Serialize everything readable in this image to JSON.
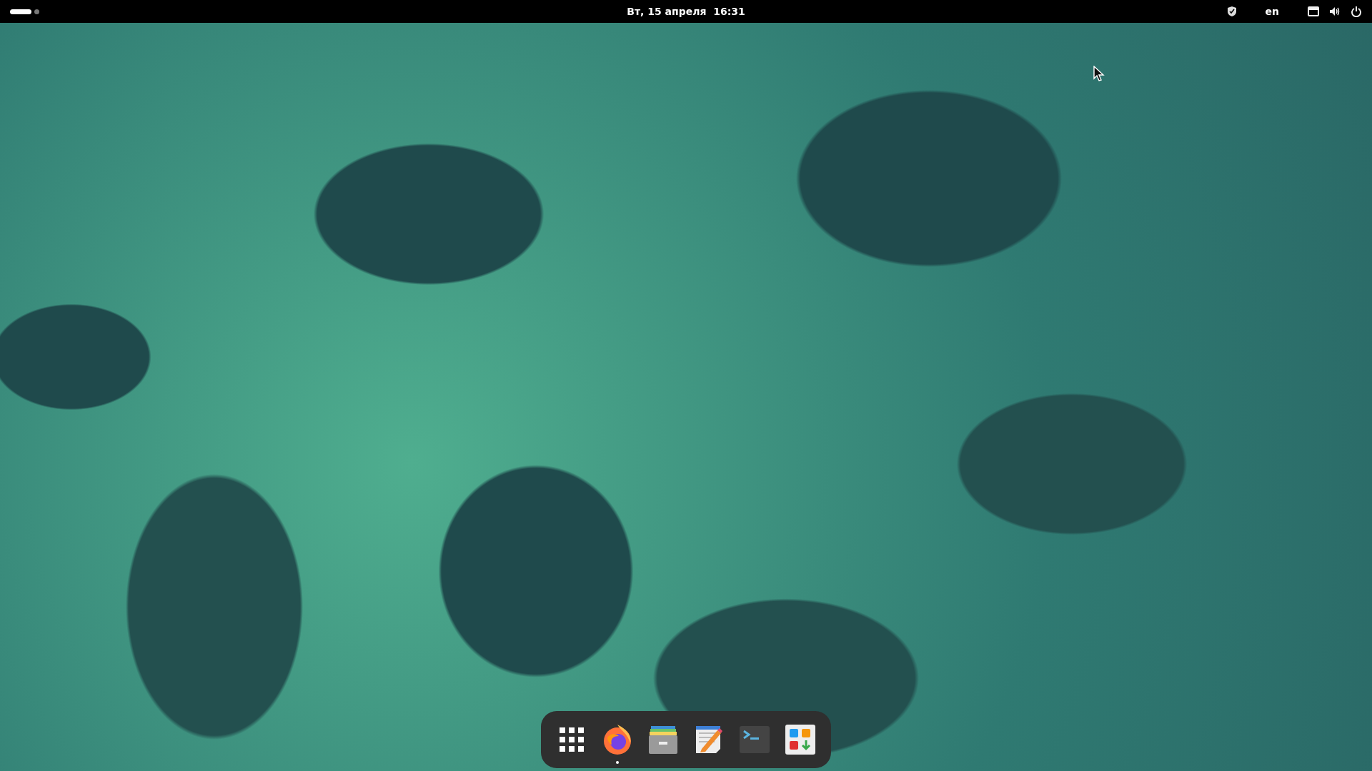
{
  "top_bar": {
    "workspaces": [
      {
        "selected": true
      },
      {
        "selected": false
      }
    ],
    "clock": "Вт, 15 апреля  16:31",
    "keyboard_layout": "en"
  },
  "dock": {
    "items": [
      {
        "kind": "app-grid",
        "running": false
      },
      {
        "kind": "browser",
        "running": true
      },
      {
        "kind": "files",
        "running": false
      },
      {
        "kind": "editor",
        "running": false
      },
      {
        "kind": "terminal",
        "running": false
      },
      {
        "kind": "software",
        "running": false
      }
    ]
  }
}
